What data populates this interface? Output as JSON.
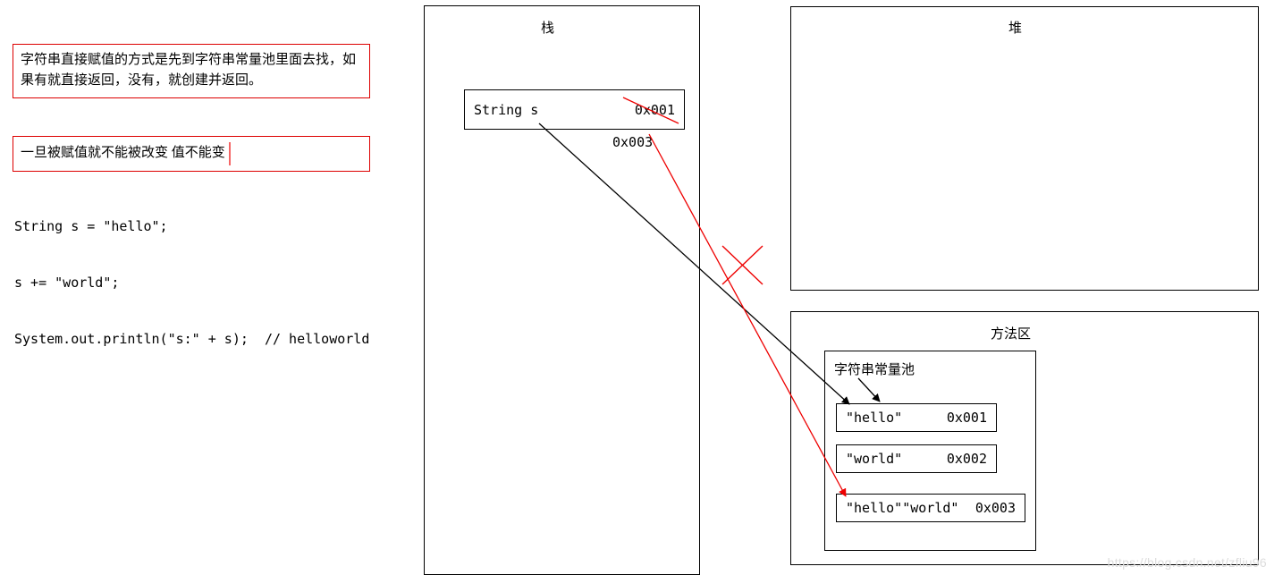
{
  "notes": {
    "box1": "字符串直接赋值的方式是先到字符串常量池里面去找，如果有就直接返回，没有，就创建并返回。",
    "box2": "一旦被赋值就不能被改变    值不能变"
  },
  "code": "String s = \"hello\";\n\ns += \"world\";\n\nSystem.out.println(\"s:\" + s);  // helloworld",
  "stack": {
    "title": "栈",
    "var": "String s",
    "addr1": "0x001",
    "addr2": "0x003"
  },
  "heap": {
    "title": "堆"
  },
  "method_area": {
    "title": "方法区",
    "pool_label": "字符串常量池",
    "rows": [
      {
        "val": "\"hello\"",
        "addr": "0x001"
      },
      {
        "val": "\"world\"",
        "addr": "0x002"
      },
      {
        "val": "\"hello\"\"world\"",
        "addr": "0x003"
      }
    ]
  },
  "watermark": "https://blog.csdn.net/zfliu96"
}
